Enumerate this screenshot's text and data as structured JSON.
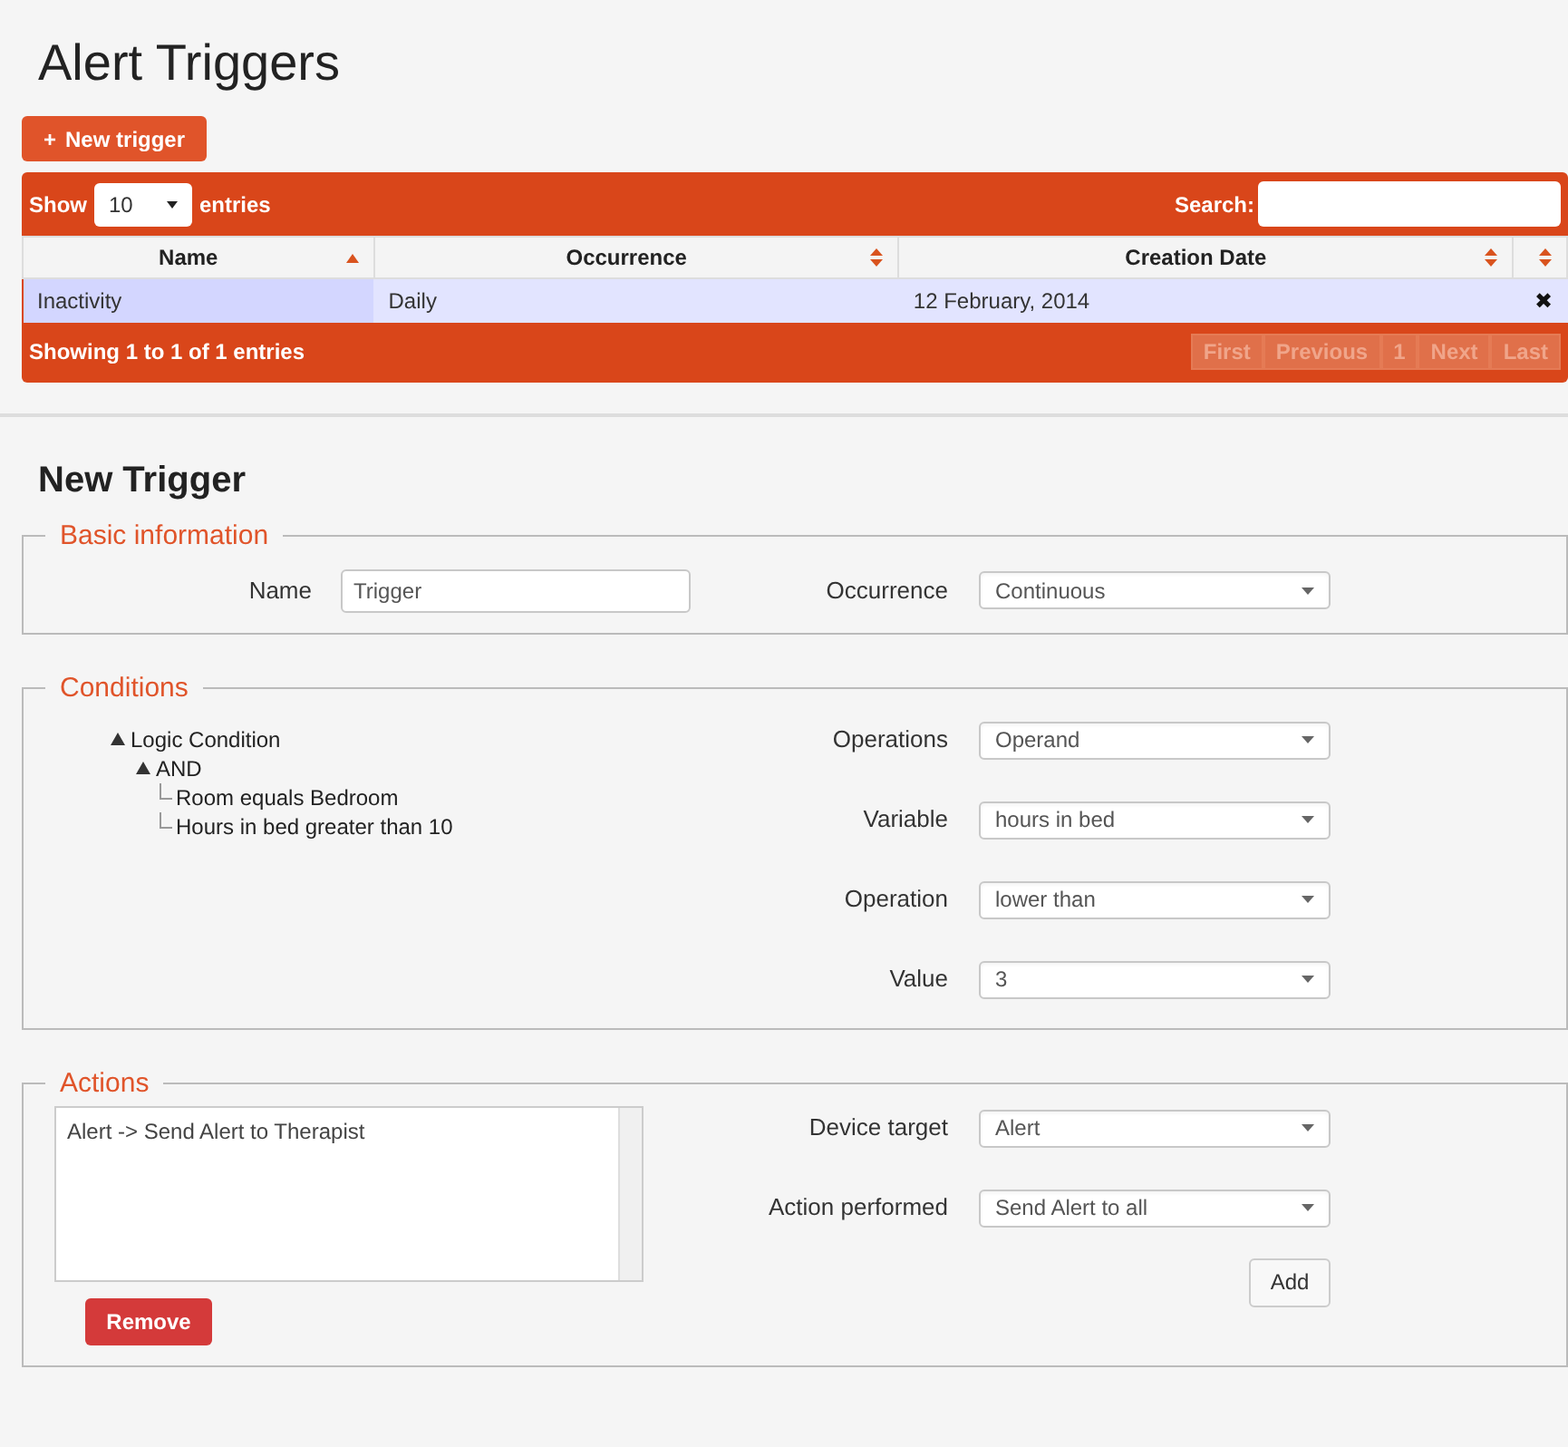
{
  "title": "Alert Triggers",
  "new_trigger_button": {
    "icon": "+",
    "label": "New trigger"
  },
  "table": {
    "show_label": "Show",
    "page_size": "10",
    "entries_label": "entries",
    "search_label": "Search:",
    "columns": [
      {
        "label": "Name",
        "sorted": true
      },
      {
        "label": "Occurrence",
        "sorted": false
      },
      {
        "label": "Creation Date",
        "sorted": false
      },
      {
        "sorted": false
      }
    ],
    "rows": [
      {
        "selected": true,
        "cells": [
          "Inactivity",
          "Daily",
          "12 February, 2014"
        ],
        "delete": "✖"
      }
    ],
    "info": "Showing 1 to 1 of 1 entries",
    "pagination": [
      {
        "label": "First",
        "disabled": true
      },
      {
        "label": "Previous",
        "disabled": true
      },
      {
        "label": "1",
        "disabled": true
      },
      {
        "label": "Next",
        "disabled": true
      },
      {
        "label": "Last",
        "disabled": true
      }
    ]
  },
  "form_title": "New Trigger",
  "basic_information": {
    "legend": "Basic information",
    "name_label": "Name",
    "name_value": "Trigger",
    "occurrence_label": "Occurrence",
    "occurrence_value": "Continuous"
  },
  "conditions": {
    "legend": "Conditions",
    "tree": [
      {
        "label": "Logic Condition",
        "expanded": true,
        "children": [
          {
            "label": "AND",
            "expanded": true,
            "children": [
              {
                "label": "Room equals Bedroom"
              },
              {
                "label": "Hours in bed greater than 10"
              }
            ]
          }
        ]
      }
    ],
    "fields": [
      {
        "label": "Operations",
        "value": "Operand"
      },
      {
        "label": "Variable",
        "value": "hours in bed"
      },
      {
        "label": "Operation",
        "value": "lower than"
      },
      {
        "label": "Value",
        "value": "3"
      }
    ]
  },
  "actions": {
    "legend": "Actions",
    "list": [
      "Alert -> Send Alert to Therapist"
    ],
    "remove_button": "Remove",
    "fields": [
      {
        "label": "Device target",
        "value": "Alert"
      },
      {
        "label": "Action performed",
        "value": "Send Alert to all"
      }
    ],
    "add_button": "Add"
  }
}
